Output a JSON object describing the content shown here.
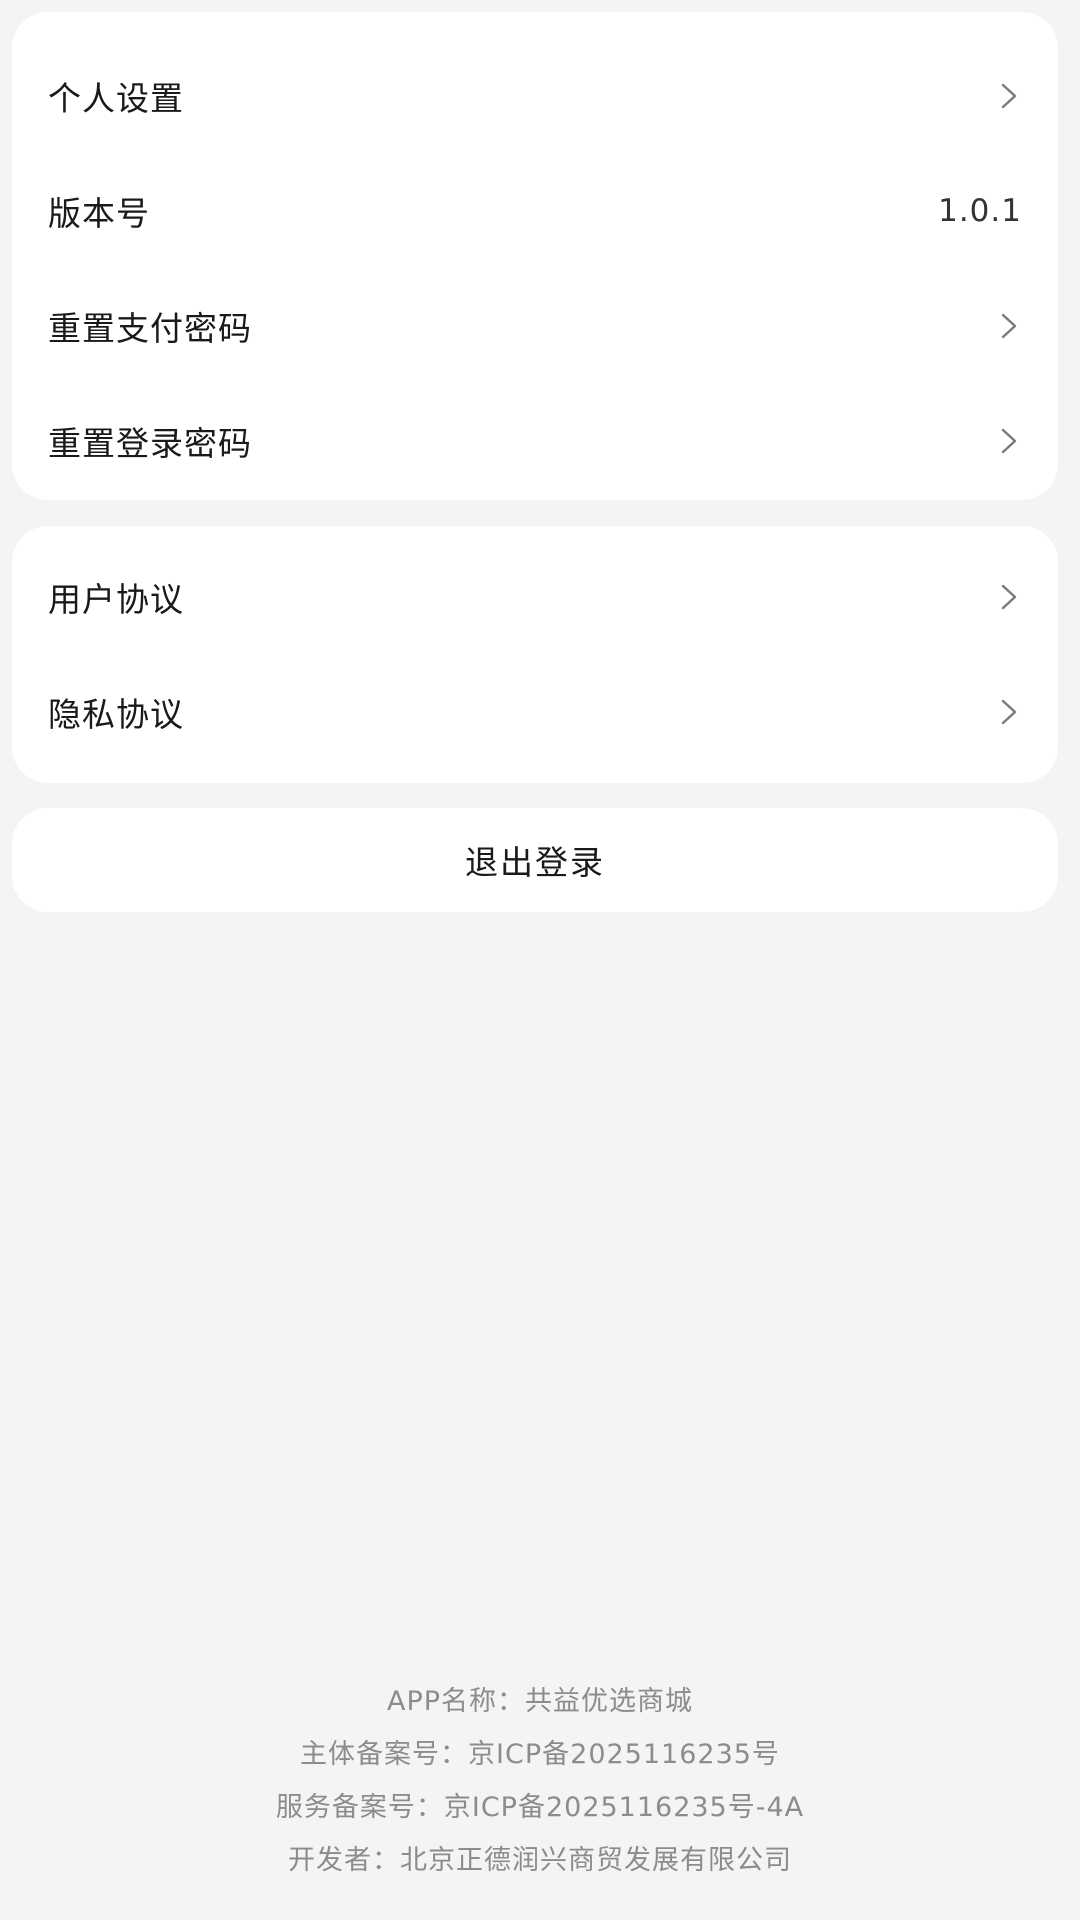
{
  "settings": {
    "items": [
      {
        "label": "个人设置",
        "value": null,
        "icon": "chevron-right-icon"
      },
      {
        "label": "版本号",
        "value": "1.0.1",
        "icon": null
      },
      {
        "label": "重置支付密码",
        "value": null,
        "icon": "chevron-right-icon"
      },
      {
        "label": "重置登录密码",
        "value": null,
        "icon": "chevron-right-icon"
      }
    ]
  },
  "agreements": {
    "items": [
      {
        "label": "用户协议",
        "icon": "chevron-right-icon"
      },
      {
        "label": "隐私协议",
        "icon": "chevron-right-icon"
      }
    ]
  },
  "logout": {
    "label": "退出登录"
  },
  "footer": {
    "app_name": "APP名称：共益优选商城",
    "entity_record": "主体备案号：京ICP备2025116235号",
    "service_record": "服务备案号：京ICP备2025116235号-4A",
    "developer": "开发者：北京正德润兴商贸发展有限公司"
  },
  "colors": {
    "background": "#f4f4f4",
    "card": "#ffffff",
    "text_primary": "#1a1a1a",
    "text_secondary": "#8c8c8c",
    "chevron": "#7a7a7a"
  }
}
